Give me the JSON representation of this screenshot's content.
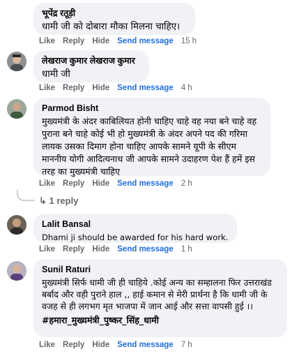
{
  "actions": {
    "like": "Like",
    "reply": "Reply",
    "hide": "Hide",
    "send_message": "Send message"
  },
  "comments": [
    {
      "author": "भूपेंद्र रतूड़ी",
      "text": "धामी जी को दोबारा मौका मिलना चाहिए।",
      "time": "15 h"
    },
    {
      "author": "लेखराज कुमार लेखराज कुमार",
      "text": "धामी जी",
      "time": "4 h"
    },
    {
      "author": "Parmod Bisht",
      "text": "मुख्यमंत्री के अंदर काबिलियत होनी चाहिए चाहे वह नया बने चाहे वह पुराना बने चाहे कोई भी हो मुख्यमंत्री के अंदर अपने पद की गरिमा लायक उसका दिमाग होना चाहिए आपके सामने यूपी के सीएम माननीय योगी आदित्यनाथ जी आपके सामने उदाहरण पेश हैं हमें इस तरह का मुख्यमंत्री चाहिए",
      "time": "2 h",
      "replies_label": "1 reply"
    },
    {
      "author": "Lalit Bansal",
      "text": "Dhami ji should be awarded for his hard work.",
      "time": "1 h"
    },
    {
      "author": "Sunil Raturi",
      "text": "मुख्यमंत्री सिर्फ धामी जी ही चाहिये .कोई अन्य का सम्हालना फिर उत्तराखंड बर्बाद और वही पुराने हाल ,, हाई कमान से मेरी प्रार्थना है कि धामी जी के वजह से ही लगभग मृत भाजपा में जान आई और सत्ता वापसी हुई ।।",
      "hashtag": "#हमारा_मुख्यमंत्री_पुष्कर_सिंह_धामी",
      "time": "7 h"
    }
  ]
}
